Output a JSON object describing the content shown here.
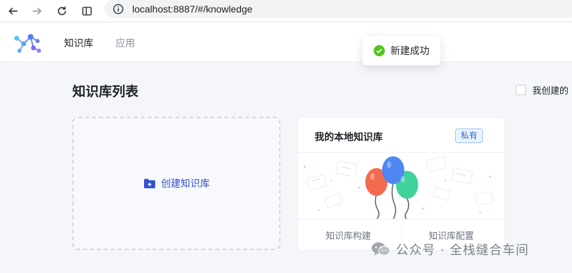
{
  "browser": {
    "url": "localhost:8887/#/knowledge",
    "icons": [
      "back-arrow-icon",
      "forward-arrow-icon",
      "reload-icon",
      "sidebar-icon",
      "info-icon"
    ]
  },
  "header": {
    "nav": [
      {
        "label": "知识库",
        "active": true
      },
      {
        "label": "应用",
        "active": false
      }
    ]
  },
  "toast": {
    "text": "新建成功",
    "icon": "check-circle-icon",
    "color": "#52c41a"
  },
  "main": {
    "title": "知识库列表",
    "filter_label": "我创建的",
    "create_card": {
      "label": "创建知识库",
      "icon": "folder-plus-icon",
      "color": "#3451d1"
    },
    "knowledge_bases": [
      {
        "name": "我的本地知识库",
        "badge": "私有",
        "actions": [
          "知识库构建",
          "知识库配置"
        ]
      }
    ]
  },
  "watermark": {
    "text": "公众号 · 全栈缝合车间",
    "icon": "wechat-icon"
  }
}
